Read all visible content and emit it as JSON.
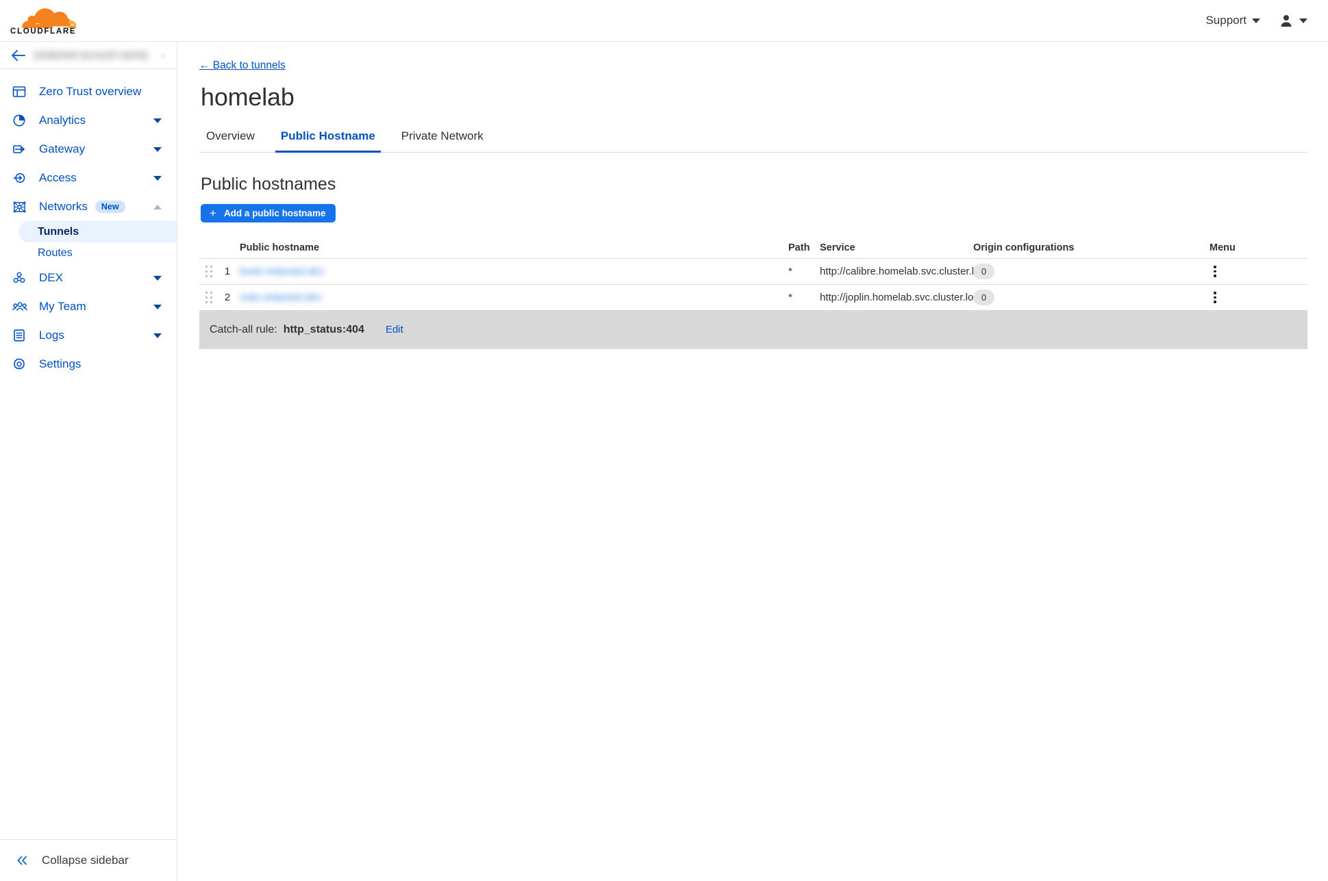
{
  "topbar": {
    "logo_alt": "Cloudflare",
    "support_label": "Support",
    "support_caret_icon": "chevron-down-icon",
    "user_icon": "user-avatar-icon",
    "user_caret_icon": "chevron-down-icon"
  },
  "sidebar": {
    "account": {
      "back_icon": "arrow-left-icon",
      "name": "[redacted account name]",
      "caret_icon": "chevron-right-icon"
    },
    "items": [
      {
        "label": "Zero Trust overview",
        "icon": "window-overview-icon",
        "expandable": false,
        "expanded": false
      },
      {
        "label": "Analytics",
        "icon": "pie-chart-icon",
        "expandable": true,
        "expanded": false
      },
      {
        "label": "Gateway",
        "icon": "gateway-arrow-icon",
        "expandable": true,
        "expanded": false
      },
      {
        "label": "Access",
        "icon": "access-circle-arrow-icon",
        "expandable": true,
        "expanded": false
      },
      {
        "label": "Networks",
        "icon": "network-nodes-icon",
        "badge": "New",
        "expandable": true,
        "expanded": true
      },
      {
        "label": "DEX",
        "icon": "dex-molecule-icon",
        "expandable": true,
        "expanded": false
      },
      {
        "label": "My Team",
        "icon": "team-people-icon",
        "expandable": true,
        "expanded": false
      },
      {
        "label": "Logs",
        "icon": "logs-list-icon",
        "expandable": true,
        "expanded": false
      },
      {
        "label": "Settings",
        "icon": "gear-icon",
        "expandable": false,
        "expanded": false
      }
    ],
    "networks_children": [
      {
        "label": "Tunnels",
        "active": true
      },
      {
        "label": "Routes",
        "active": false
      }
    ],
    "collapse": {
      "label": "Collapse sidebar",
      "icon": "double-chevron-left-icon"
    }
  },
  "main": {
    "back_link": "← Back to tunnels",
    "page_title": "homelab",
    "tabs": [
      {
        "label": "Overview",
        "active": false
      },
      {
        "label": "Public Hostname",
        "active": true
      },
      {
        "label": "Private Network",
        "active": false
      }
    ],
    "section_title": "Public hostnames",
    "add_button": {
      "label": "Add a public hostname",
      "icon": "plus-icon"
    },
    "table": {
      "columns": [
        "Public hostname",
        "Path",
        "Service",
        "Origin configurations",
        "Menu"
      ],
      "rows": [
        {
          "index": "1",
          "hostname": "book.redacted.dev",
          "hostname_redacted": true,
          "path": "*",
          "service": "http://calibre.homelab.svc.cluster.local",
          "origin_configurations": "0",
          "menu_icon": "kebab-menu-icon",
          "drag_icon": "drag-handle-icon"
        },
        {
          "index": "2",
          "hostname": "note.redacted.dev",
          "hostname_redacted": true,
          "path": "*",
          "service": "http://joplin.homelab.svc.cluster.local",
          "origin_configurations": "0",
          "menu_icon": "kebab-menu-icon",
          "drag_icon": "drag-handle-icon"
        }
      ]
    },
    "catch_all": {
      "label": "Catch-all rule:",
      "value": "http_status:404",
      "edit_label": "Edit"
    }
  },
  "colors": {
    "brand_orange": "#f6821f",
    "link_blue": "#0051c3",
    "button_blue": "#1674eb",
    "active_pill": "#e9f2fe",
    "badge_blue": "#cfe3fb",
    "catchall_bg": "#d8d8d8",
    "border": "#d9d9d9"
  }
}
